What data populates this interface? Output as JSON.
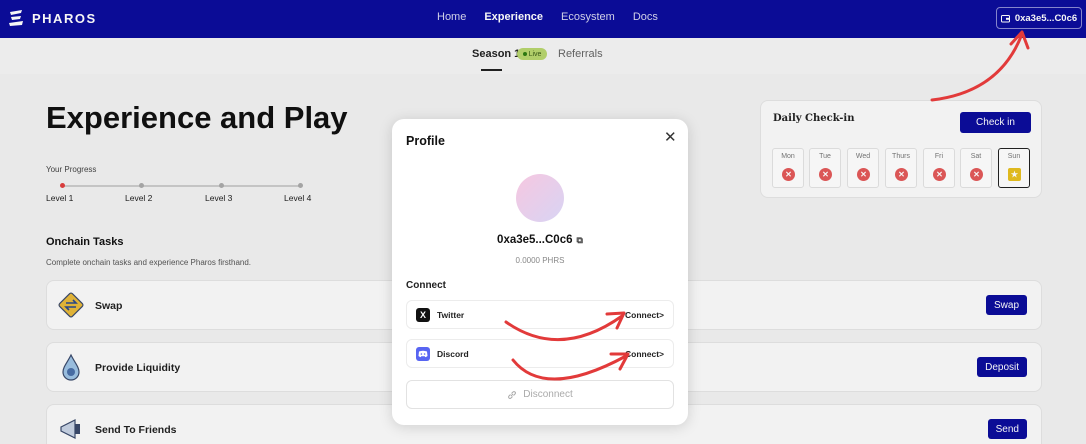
{
  "nav": {
    "brand": "PHAROS",
    "links": [
      {
        "label": "Home",
        "active": false
      },
      {
        "label": "Experience",
        "active": true
      },
      {
        "label": "Ecosystem",
        "active": false
      },
      {
        "label": "Docs",
        "active": false
      }
    ],
    "wallet_address": "0xa3e5...C0c6"
  },
  "subnav": {
    "season_label": "Season 1",
    "live_badge": "Live",
    "referrals_label": "Referrals"
  },
  "hero": {
    "title": "Experience and Play",
    "progress_label": "Your Progress",
    "levels": [
      "Level 1",
      "Level 2",
      "Level 3",
      "Level 4"
    ],
    "current_level_index": 0
  },
  "tasks": {
    "title": "Onchain Tasks",
    "subtitle": "Complete onchain tasks and experience Pharos firsthand.",
    "items": [
      {
        "name": "Swap",
        "button": "Swap",
        "icon": "swap-icon"
      },
      {
        "name": "Provide Liquidity",
        "button": "Deposit",
        "icon": "liquidity-drop-icon"
      },
      {
        "name": "Send To Friends",
        "button": "Send",
        "icon": "send-megaphone-icon"
      }
    ]
  },
  "checkin": {
    "title": "Daily Check-in",
    "button": "Check in",
    "days": [
      {
        "name": "Mon",
        "status": "missed"
      },
      {
        "name": "Tue",
        "status": "missed"
      },
      {
        "name": "Wed",
        "status": "missed"
      },
      {
        "name": "Thurs",
        "status": "missed"
      },
      {
        "name": "Fri",
        "status": "missed"
      },
      {
        "name": "Sat",
        "status": "missed"
      },
      {
        "name": "Sun",
        "status": "today"
      }
    ]
  },
  "profile_modal": {
    "title": "Profile",
    "address": "0xa3e5...C0c6",
    "balance": "0.0000 PHRS",
    "connect_label": "Connect",
    "socials": [
      {
        "name": "Twitter",
        "action": "Connect>",
        "icon": "x-logo-icon"
      },
      {
        "name": "Discord",
        "action": "Connect>",
        "icon": "discord-logo-icon"
      }
    ],
    "disconnect_label": "Disconnect"
  },
  "colors": {
    "brand": "#0c0d9c",
    "annotation_arrow": "#e23a3a",
    "missed": "#e35a5a",
    "live": "#b8d66e"
  }
}
